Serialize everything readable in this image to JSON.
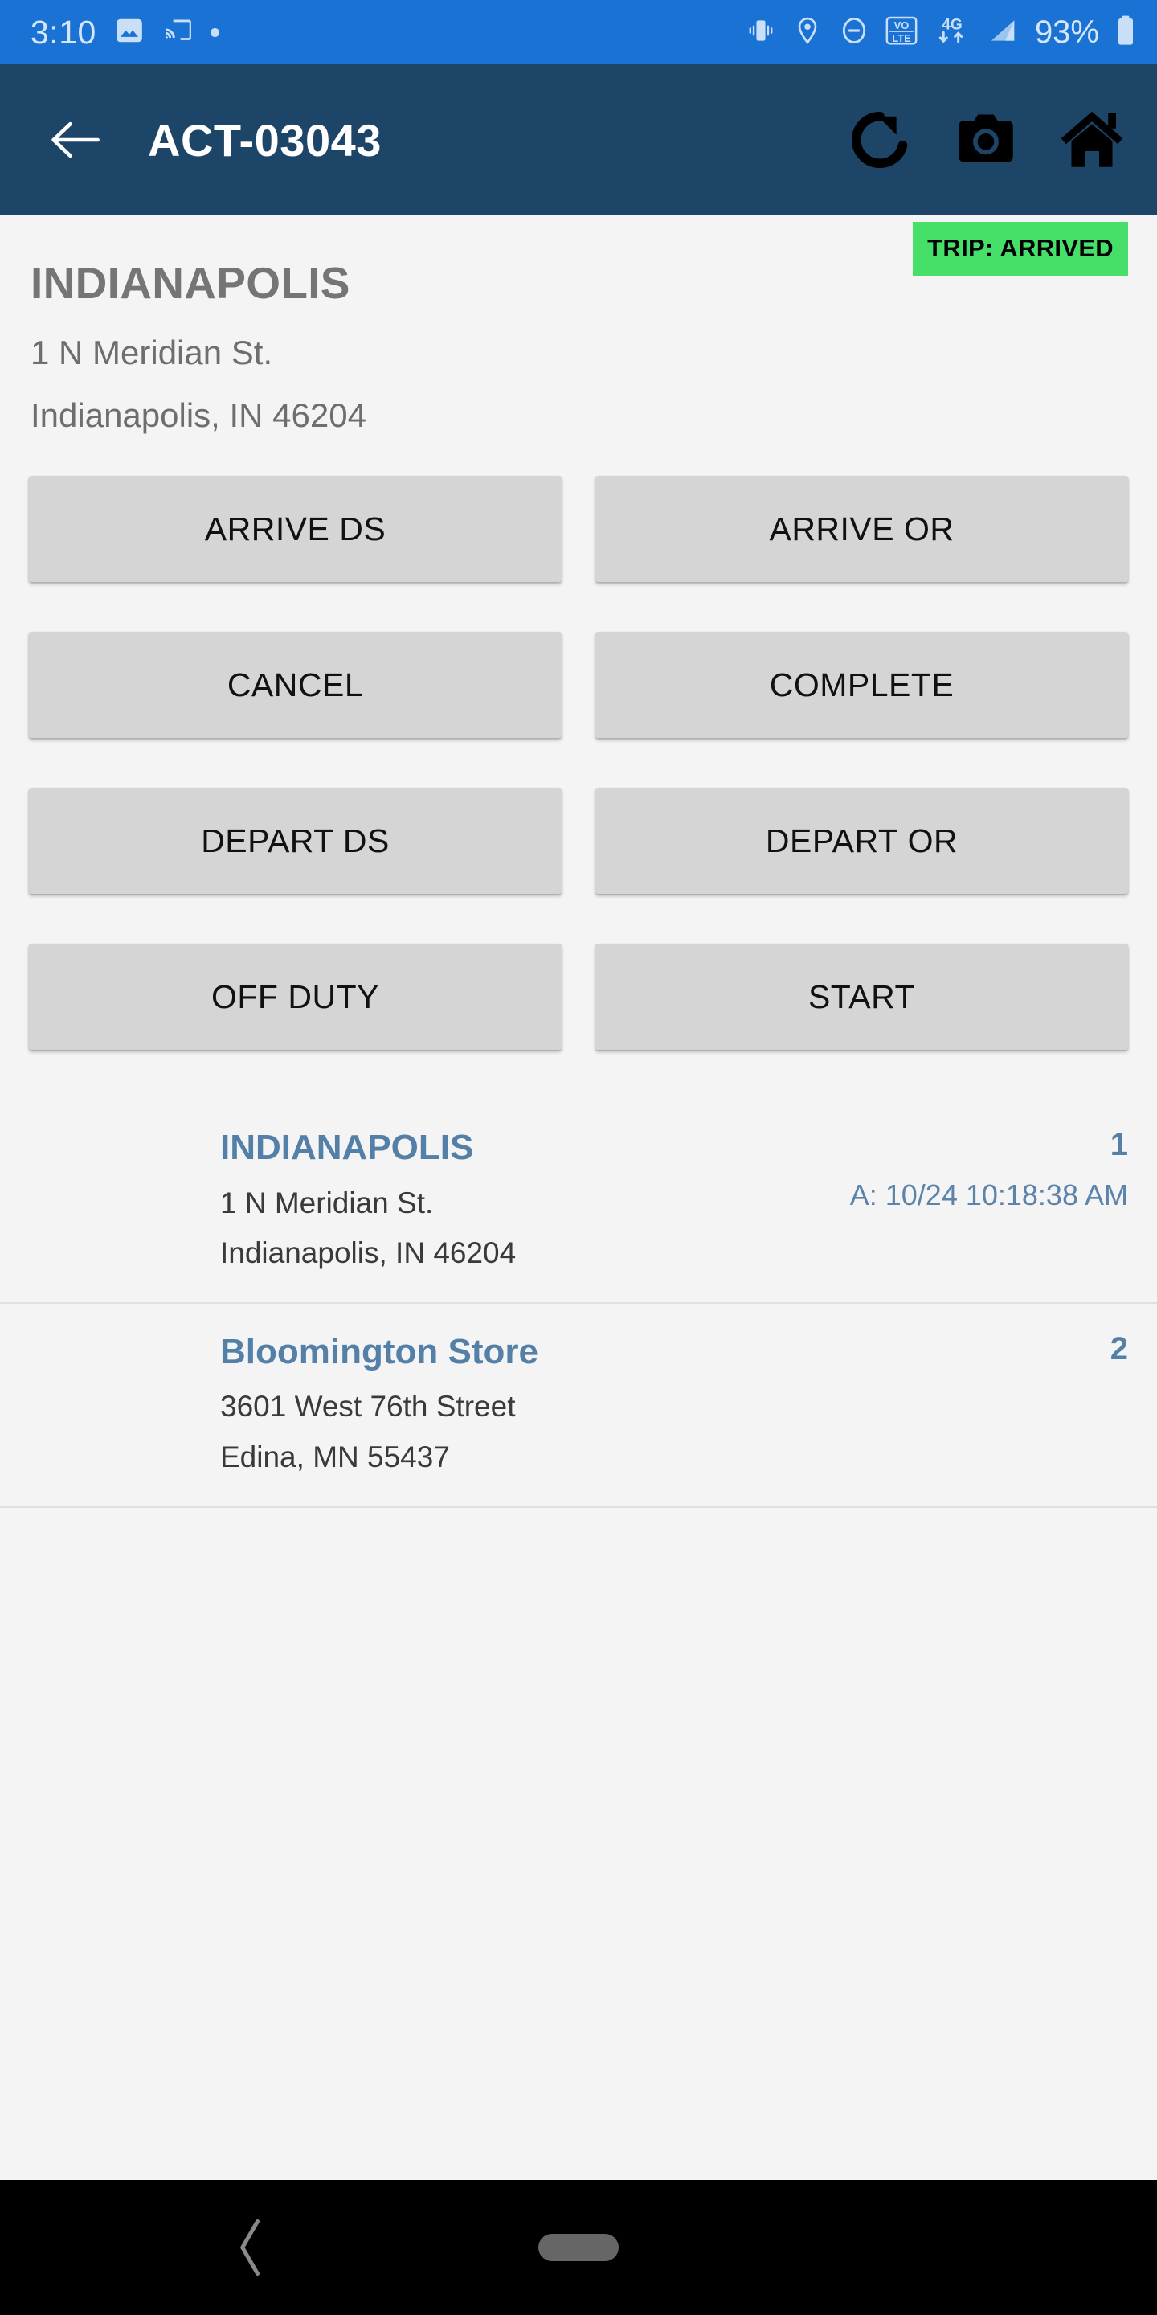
{
  "status_bar": {
    "time": "3:10",
    "battery_percent": "93%",
    "left_icons": [
      "image-icon",
      "cast-icon",
      "dot-indicator"
    ],
    "right_icons": [
      "vibrate-icon",
      "location-icon",
      "do-not-disturb-icon",
      "volte-icon",
      "4g-data-icon",
      "signal-icon",
      "battery-icon"
    ],
    "volte_top": "VO",
    "volte_bottom": "LTE",
    "network_label": "4G",
    "background_color": "#1a73d4"
  },
  "app_bar": {
    "title": "ACT-03043",
    "back_label": "back-arrow",
    "actions": [
      "refresh-icon",
      "camera-icon",
      "home-icon"
    ],
    "background_color": "#1d4568"
  },
  "header": {
    "location_name": "INDIANAPOLIS",
    "address_line1": "1 N Meridian St.",
    "address_line2": "Indianapolis, IN 46204",
    "trip_status_badge": "TRIP: ARRIVED",
    "badge_color": "#46e069"
  },
  "actions": {
    "buttons": [
      {
        "label": "ARRIVE DS",
        "name": "arrive-ds-button"
      },
      {
        "label": "ARRIVE OR",
        "name": "arrive-or-button"
      },
      {
        "label": "CANCEL",
        "name": "cancel-button"
      },
      {
        "label": "COMPLETE",
        "name": "complete-button"
      },
      {
        "label": "DEPART DS",
        "name": "depart-ds-button"
      },
      {
        "label": "DEPART OR",
        "name": "depart-or-button"
      },
      {
        "label": "OFF DUTY",
        "name": "off-duty-button"
      },
      {
        "label": "START",
        "name": "start-button"
      }
    ]
  },
  "stops": [
    {
      "name": "INDIANAPOLIS",
      "address_line1": "1 N Meridian St.",
      "address_line2": "Indianapolis, IN 46204",
      "sequence": "1",
      "arrival": "A: 10/24 10:18:38 AM"
    },
    {
      "name": "Bloomington Store",
      "address_line1": "3601 West 76th Street",
      "address_line2": "Edina, MN 55437",
      "sequence": "2",
      "arrival": ""
    }
  ],
  "nav_bar": {
    "back_label": "system-back",
    "home_label": "home-indicator"
  }
}
